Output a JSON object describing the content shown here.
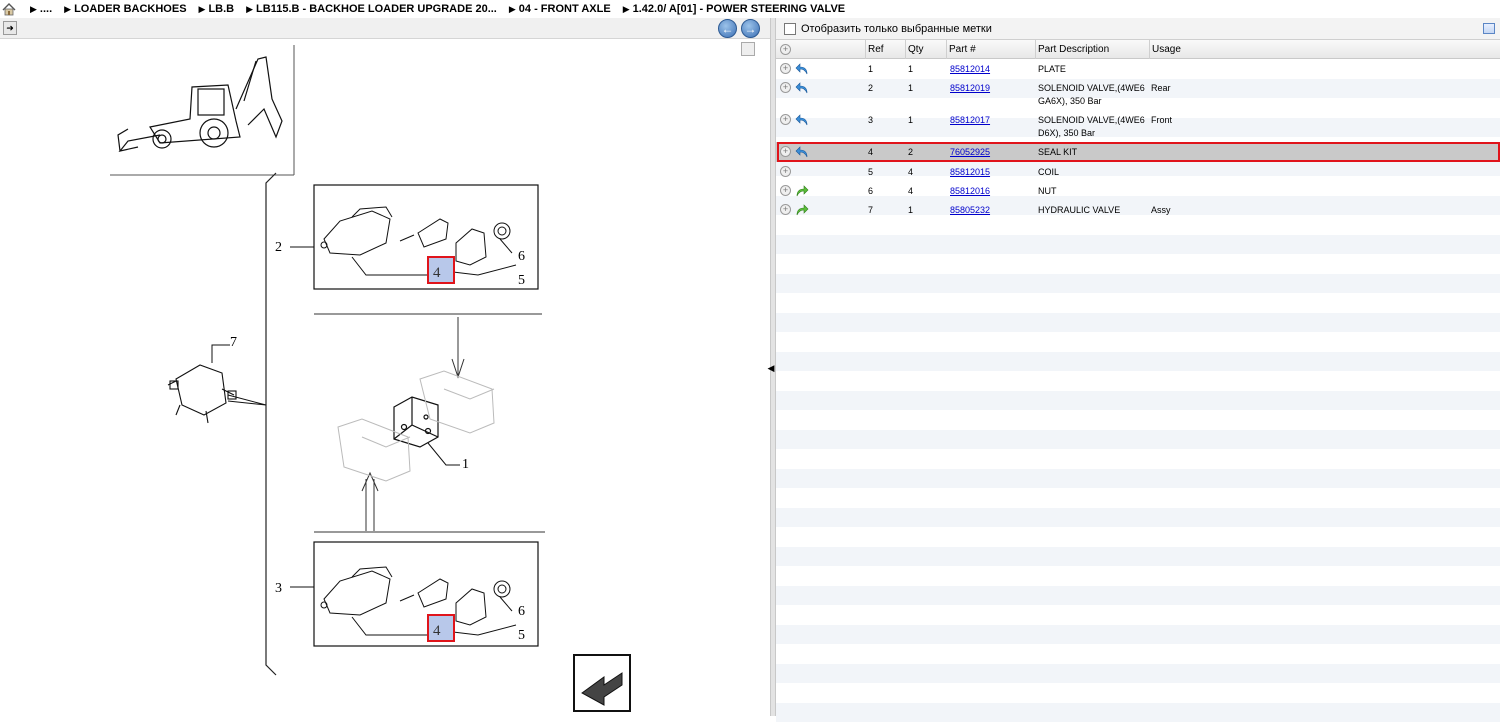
{
  "breadcrumb": {
    "items": [
      {
        "label": "...."
      },
      {
        "label": "LOADER BACKHOES"
      },
      {
        "label": "LB.B"
      },
      {
        "label": "LB115.B - BACKHOE LOADER UPGRADE 20..."
      },
      {
        "label": "04 - FRONT AXLE"
      },
      {
        "label": "1.42.0/  A[01] - POWER STEERING VALVE"
      }
    ]
  },
  "drawing": {
    "callouts": {
      "n2": "2",
      "n3": "3",
      "n7": "7",
      "n1": "1",
      "n4a": "4",
      "n5a": "5",
      "n6a": "6",
      "n4b": "4",
      "n5b": "5",
      "n6b": "6"
    }
  },
  "filter": {
    "label": "Отобразить только выбранные метки",
    "checked": false
  },
  "grid": {
    "columns": {
      "ref": "Ref",
      "qty": "Qty",
      "part": "Part #",
      "desc": "Part Description",
      "usage": "Usage"
    },
    "rows": [
      {
        "ref": "1",
        "qty": "1",
        "part": "85812014",
        "desc1": "PLATE",
        "desc2": "",
        "usage": "",
        "icon": "blue"
      },
      {
        "ref": "2",
        "qty": "1",
        "part": "85812019",
        "desc1": "SOLENOID VALVE,(4WE6",
        "desc2": "GA6X), 350 Bar",
        "usage": "Rear",
        "icon": "blue"
      },
      {
        "ref": "3",
        "qty": "1",
        "part": "85812017",
        "desc1": "SOLENOID VALVE,(4WE6",
        "desc2": "D6X), 350 Bar",
        "usage": "Front",
        "icon": "blue"
      },
      {
        "ref": "4",
        "qty": "2",
        "part": "76052925",
        "desc1": "SEAL KIT",
        "desc2": "",
        "usage": "",
        "icon": "blue",
        "selected": true
      },
      {
        "ref": "5",
        "qty": "4",
        "part": "85812015",
        "desc1": "COIL",
        "desc2": "",
        "usage": "",
        "icon": "none"
      },
      {
        "ref": "6",
        "qty": "4",
        "part": "85812016",
        "desc1": "NUT",
        "desc2": "",
        "usage": "",
        "icon": "green"
      },
      {
        "ref": "7",
        "qty": "1",
        "part": "85805232",
        "desc1": "HYDRAULIC VALVE",
        "desc2": "",
        "usage": "Assy",
        "icon": "green"
      }
    ]
  },
  "colors": {
    "selection_border": "#e0141b",
    "selection_fill": "#c9c9c9",
    "link": "#0000cc",
    "stripe": "#f2f5f9"
  },
  "icons": {
    "home": "home-icon",
    "back": "arrow-left-icon",
    "forward": "arrow-right-icon",
    "return_arrow_blue": "return-arrow-icon",
    "forward_arrow_green": "green-arrow-icon"
  }
}
